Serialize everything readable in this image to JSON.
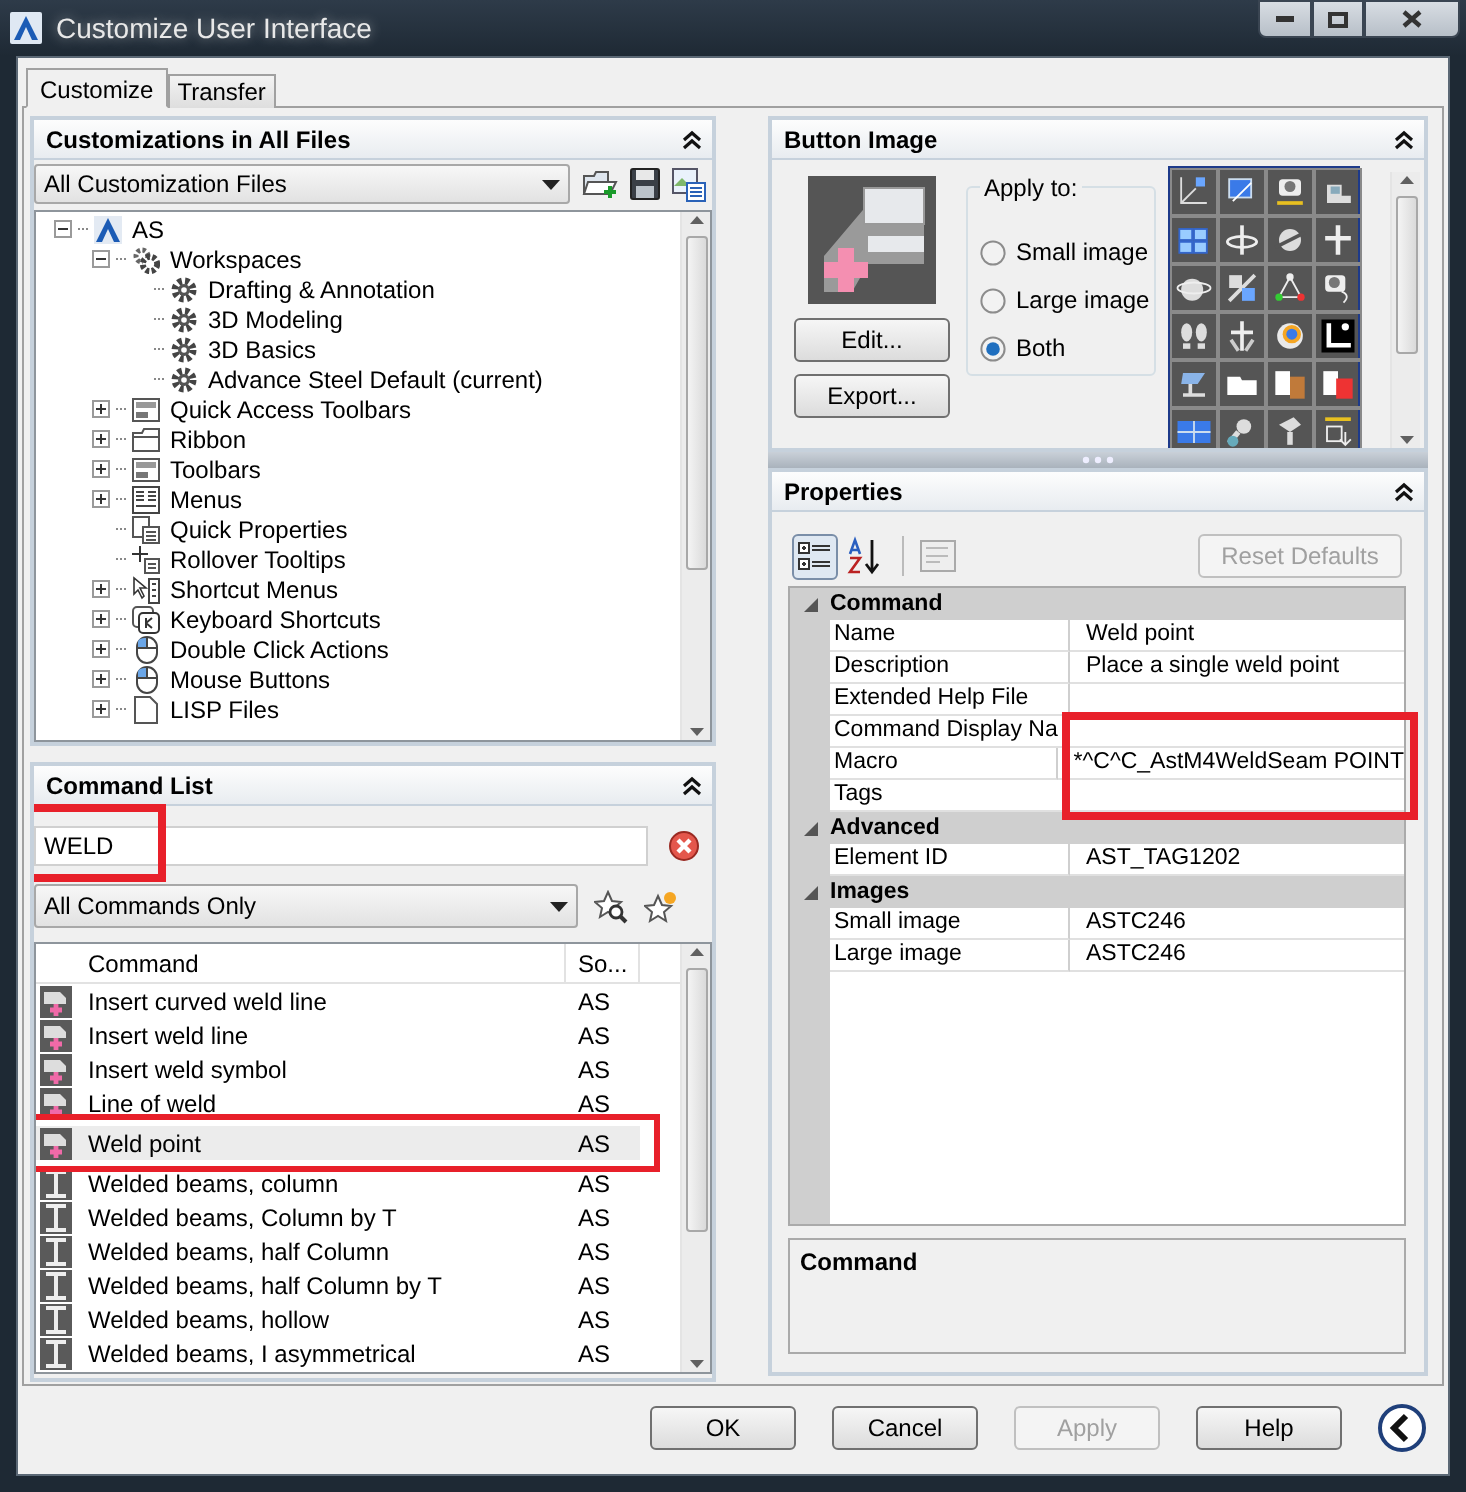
{
  "window": {
    "title": "Customize User Interface"
  },
  "tabs": [
    {
      "label": "Customize",
      "selected": true
    },
    {
      "label": "Transfer",
      "selected": false
    }
  ],
  "customizations": {
    "title": "Customizations in All Files",
    "file_filter": "All Customization Files",
    "tree": [
      {
        "label": "AS",
        "kind": "logo",
        "expanded": true,
        "children": [
          {
            "label": "Workspaces",
            "kind": "gears",
            "expanded": true,
            "children": [
              {
                "label": "Drafting & Annotation",
                "kind": "gear"
              },
              {
                "label": "3D Modeling",
                "kind": "gear"
              },
              {
                "label": "3D Basics",
                "kind": "gear"
              },
              {
                "label": "Advance Steel Default (current)",
                "kind": "gear"
              }
            ]
          },
          {
            "label": "Quick Access Toolbars",
            "kind": "toolbar",
            "expanded": false
          },
          {
            "label": "Ribbon",
            "kind": "ribbon",
            "expanded": false
          },
          {
            "label": "Toolbars",
            "kind": "toolbar",
            "expanded": false
          },
          {
            "label": "Menus",
            "kind": "menu",
            "expanded": false
          },
          {
            "label": "Quick Properties",
            "kind": "properties"
          },
          {
            "label": "Rollover Tooltips",
            "kind": "tooltip"
          },
          {
            "label": "Shortcut Menus",
            "kind": "shortcut",
            "expanded": false
          },
          {
            "label": "Keyboard Shortcuts",
            "kind": "keyboard",
            "expanded": false
          },
          {
            "label": "Double Click Actions",
            "kind": "mouse",
            "expanded": false
          },
          {
            "label": "Mouse Buttons",
            "kind": "mouse",
            "expanded": false
          },
          {
            "label": "LISP Files",
            "kind": "file",
            "expanded": false
          }
        ]
      }
    ]
  },
  "command_list": {
    "title": "Command List",
    "search": {
      "value": "WELD",
      "highlighted": true
    },
    "filter": "All Commands Only",
    "columns": [
      "Command",
      "So..."
    ],
    "rows": [
      {
        "command": "Insert curved weld line",
        "source": "AS",
        "kind": "weld",
        "selected": false,
        "highlighted": false
      },
      {
        "command": "Insert weld line",
        "source": "AS",
        "kind": "weld",
        "selected": false,
        "highlighted": false
      },
      {
        "command": "Insert weld symbol",
        "source": "AS",
        "kind": "weld",
        "selected": false,
        "highlighted": false
      },
      {
        "command": "Line of weld",
        "source": "AS",
        "kind": "weld",
        "selected": false,
        "highlighted": false
      },
      {
        "command": "Weld point",
        "source": "AS",
        "kind": "weld",
        "selected": true,
        "highlighted": true
      },
      {
        "command": "Welded beams, column",
        "source": "AS",
        "kind": "beam",
        "selected": false,
        "highlighted": false
      },
      {
        "command": "Welded beams, Column by T",
        "source": "AS",
        "kind": "beam",
        "selected": false,
        "highlighted": false
      },
      {
        "command": "Welded beams, half Column",
        "source": "AS",
        "kind": "beam",
        "selected": false,
        "highlighted": false
      },
      {
        "command": "Welded beams, half Column by T",
        "source": "AS",
        "kind": "beam",
        "selected": false,
        "highlighted": false
      },
      {
        "command": "Welded beams, hollow",
        "source": "AS",
        "kind": "beam",
        "selected": false,
        "highlighted": false
      },
      {
        "command": "Welded beams, I asymmetrical",
        "source": "AS",
        "kind": "beam",
        "selected": false,
        "highlighted": false
      }
    ]
  },
  "button_image": {
    "title": "Button Image",
    "apply_to": {
      "label": "Apply to:",
      "options": [
        {
          "label": "Small image",
          "selected": false
        },
        {
          "label": "Large image",
          "selected": false
        },
        {
          "label": "Both",
          "selected": true
        }
      ]
    },
    "buttons": [
      "Edit...",
      "Export..."
    ]
  },
  "properties": {
    "title": "Properties",
    "reset_button": {
      "label": "Reset Defaults",
      "disabled": true
    },
    "categories": [
      {
        "name": "Command",
        "expanded": true,
        "rows": [
          {
            "name": "Name",
            "value": "Weld point",
            "highlighted": false
          },
          {
            "name": "Description",
            "value": "Place a single weld point",
            "highlighted": false
          },
          {
            "name": "Extended Help File",
            "value": "",
            "highlighted": false
          },
          {
            "name": "Command Display Na",
            "value": "",
            "highlighted": false
          },
          {
            "name": "Macro",
            "value": "*^C^C_AstM4WeldSeam POINT",
            "highlighted": true
          },
          {
            "name": "Tags",
            "value": "",
            "highlighted": false
          }
        ]
      },
      {
        "name": "Advanced",
        "expanded": true,
        "rows": [
          {
            "name": "Element ID",
            "value": "AST_TAG1202",
            "highlighted": false
          }
        ]
      },
      {
        "name": "Images",
        "expanded": true,
        "rows": [
          {
            "name": "Small image",
            "value": "ASTC246",
            "highlighted": false
          },
          {
            "name": "Large image",
            "value": "ASTC246",
            "highlighted": false
          }
        ]
      }
    ],
    "description_title": "Command"
  },
  "footer": {
    "buttons": [
      {
        "label": "OK",
        "disabled": false
      },
      {
        "label": "Cancel",
        "disabled": false
      },
      {
        "label": "Apply",
        "disabled": true
      },
      {
        "label": "Help",
        "disabled": false
      }
    ]
  }
}
